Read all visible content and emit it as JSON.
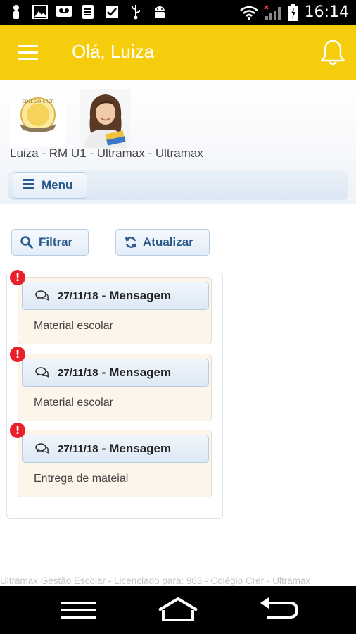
{
  "status_bar": {
    "time": "16:14",
    "icons": [
      "person-icon",
      "image-icon",
      "voicemail-icon",
      "clipboard-icon",
      "checkbox-icon",
      "usb-icon",
      "android-icon",
      "wifi-icon",
      "signal-icon",
      "battery-charging-icon"
    ]
  },
  "app_bar": {
    "title": "Olá, Luiza",
    "menu_icon": "hamburger-icon",
    "notification_icon": "bell-icon",
    "color": "#f5cd0d"
  },
  "profile": {
    "student_line": "Luiza - RM U1 - Ultramax - Ultramax",
    "logo_text": "COLÉGIO CRER"
  },
  "menu_button": {
    "label": "Menu"
  },
  "actions": {
    "filter_label": "Filtrar",
    "refresh_label": "Atualizar"
  },
  "messages": [
    {
      "date": "27/11/18",
      "separator": "-",
      "type": "Mensagem",
      "body": "Material escolar",
      "alert": "!"
    },
    {
      "date": "27/11/18",
      "separator": "-",
      "type": "Mensagem",
      "body": "Material escolar",
      "alert": "!"
    },
    {
      "date": "27/11/18",
      "separator": "-",
      "type": "Mensagem",
      "body": "Entrega de mateial",
      "alert": "!"
    }
  ],
  "footer": "Ultramax Gestão Escolar - Licenciado para: 963 - Colégio Crer - Ultramax",
  "accent_color": "#2a5a8c",
  "nav_bar": {
    "icons": [
      "recent-apps-icon",
      "home-icon",
      "back-icon"
    ]
  }
}
